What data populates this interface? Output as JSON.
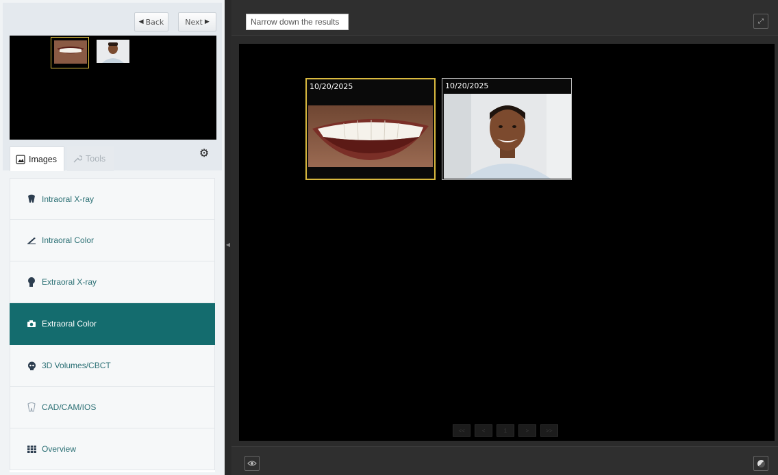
{
  "nav": {
    "back_label": "Back",
    "next_label": "Next"
  },
  "tabs": {
    "images_label": "Images",
    "tools_label": "Tools"
  },
  "categories": [
    {
      "label": "Intraoral X-ray",
      "icon": "tooth-icon"
    },
    {
      "label": "Intraoral Color",
      "icon": "intraoral-camera-icon"
    },
    {
      "label": "Extraoral X-ray",
      "icon": "head-profile-icon"
    },
    {
      "label": "Extraoral Color",
      "icon": "camera-icon",
      "active": true
    },
    {
      "label": "3D Volumes/CBCT",
      "icon": "skull-icon"
    },
    {
      "label": "CAD/CAM/IOS",
      "icon": "tooth-outline-icon"
    },
    {
      "label": "Overview",
      "icon": "grid-icon"
    }
  ],
  "search": {
    "placeholder": "Narrow down the results"
  },
  "images": [
    {
      "date": "10/20/2025",
      "subject": "smile close-up",
      "selected": true
    },
    {
      "date": "10/20/2025",
      "subject": "portrait",
      "selected": false
    }
  ],
  "pager": {
    "first": "<<",
    "prev": "<",
    "page": "1",
    "next": ">",
    "last": ">>"
  },
  "colors": {
    "accent": "#146c6e",
    "selection": "#d9b93f",
    "link_text": "#2a6f74"
  }
}
